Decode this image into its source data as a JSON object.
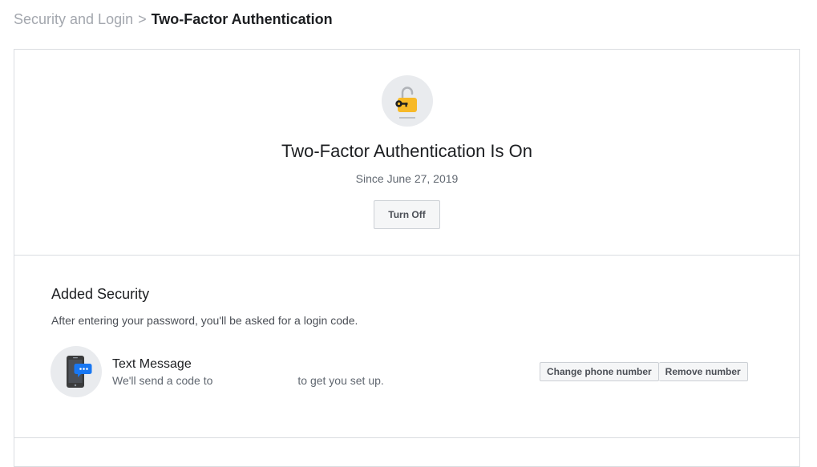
{
  "breadcrumb": {
    "parent": "Security and Login",
    "separator": ">",
    "current": "Two-Factor Authentication"
  },
  "status": {
    "title": "Two-Factor Authentication Is On",
    "since": "Since June 27, 2019",
    "turn_off_label": "Turn Off",
    "icon": "unlocked-padlock-key-icon"
  },
  "added_security": {
    "title": "Added Security",
    "description": "After entering your password, you'll be asked for a login code.",
    "method": {
      "icon": "phone-message-icon",
      "title": "Text Message",
      "desc_before": "We'll send a code to",
      "desc_after": "to get you set up.",
      "change_label": "Change phone number",
      "remove_label": "Remove number"
    }
  },
  "colors": {
    "accent_yellow": "#f7b928",
    "accent_blue": "#1877f2",
    "icon_circle": "#e9ebee",
    "border": "#dadde1"
  }
}
